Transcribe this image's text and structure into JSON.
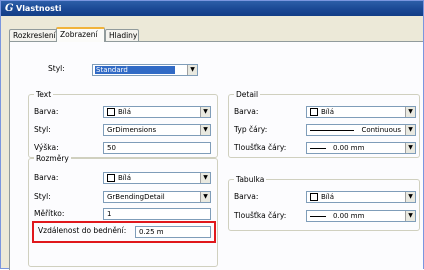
{
  "window": {
    "title": "Vlastnosti",
    "logo": "G"
  },
  "tabs": [
    {
      "label": "Rozkreslení"
    },
    {
      "label": "Zobrazení"
    },
    {
      "label": "Hladiny"
    }
  ],
  "style": {
    "label": "Styl:",
    "value": "Standard"
  },
  "text_group": {
    "title": "Text",
    "color_label": "Barva:",
    "color_value": "Bílá",
    "style_label": "Styl:",
    "style_value": "GrDimensions",
    "height_label": "Výška:",
    "height_value": "50"
  },
  "detail_group": {
    "title": "Detail",
    "color_label": "Barva:",
    "color_value": "Bílá",
    "linetype_label": "Typ čáry:",
    "linetype_value": "Continuous",
    "thickness_label": "Tloušťka čáry:",
    "thickness_value": "0.00 mm"
  },
  "dims_group": {
    "title": "Rozměry",
    "color_label": "Barva:",
    "color_value": "Bílá",
    "style_label": "Styl:",
    "style_value": "GrBendingDetail",
    "scale_label": "Měřítko:",
    "scale_value": "1",
    "distance_label": "Vzdálenost do bednění:",
    "distance_value": "0.25 m"
  },
  "table_group": {
    "title": "Tabulka",
    "color_label": "Barva:",
    "color_value": "Bílá",
    "thickness_label": "Tloušťka čáry:",
    "thickness_value": "0.00 mm"
  },
  "colors": {
    "titlebar": "#1c4a96",
    "highlight": "#e0181c",
    "selection": "#316ac5"
  }
}
